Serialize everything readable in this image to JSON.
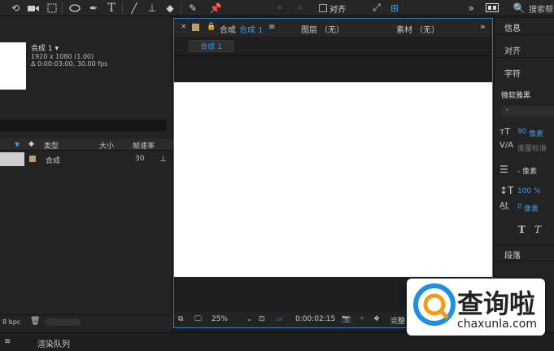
{
  "toolbar": {
    "align_label": "对齐",
    "search_label": "搜索帮",
    "icons": [
      "rotate-icon",
      "camera-icon",
      "pan-behind-icon",
      "ellipse-icon",
      "pen-icon",
      "type-icon",
      "brush-icon",
      "stamp-icon",
      "eraser-icon",
      "roto-brush-icon",
      "puppet-pin-icon"
    ]
  },
  "project": {
    "comp_name": "合成 1 ▾",
    "comp_resolution": "1920 x 1080 (1.00)",
    "comp_duration": "Δ 0:00:03:00, 30.00 fps",
    "columns": {
      "type": "类型",
      "size": "大小",
      "framerate": "帧速率"
    },
    "rows": [
      {
        "name": "合成",
        "framerate": "30"
      }
    ],
    "bpc": "8 bpc"
  },
  "viewer": {
    "tab_comp_prefix": "合成",
    "tab_comp_name": "合成 1",
    "tab_layer": "图层 （无）",
    "tab_footage": "素材 （无）",
    "subtab": "合成 1",
    "zoom": "25%",
    "timecode": "0:00:02:15",
    "quality": "完整"
  },
  "right_panel": {
    "info": "信息",
    "align": "对齐",
    "character": "字符",
    "font": "微软雅黑",
    "font_style": "-",
    "size_value": "90",
    "size_unit": "像素",
    "kerning_label": "度量标准",
    "leading_value": "- 像素",
    "vscale_value": "100",
    "vscale_unit": "%",
    "baseline_value": "0",
    "baseline_unit": "像素",
    "paragraph": "段落"
  },
  "status": {
    "render_queue": "渲染队列"
  },
  "watermark": {
    "brand": "查询啦",
    "url": "chaxunla.com"
  },
  "colors": {
    "accent": "#3a9ae8",
    "canvas": "#ffffff",
    "panel": "#232323"
  }
}
